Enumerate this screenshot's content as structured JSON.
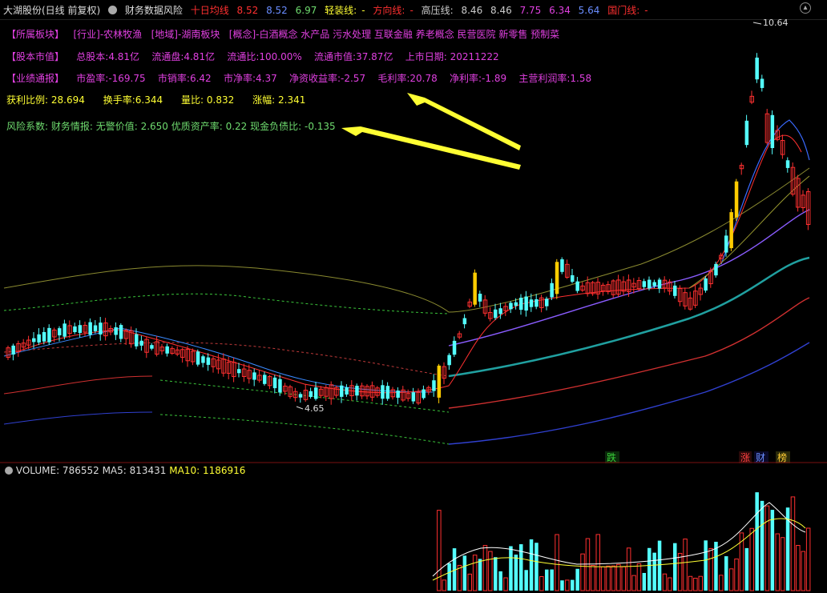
{
  "header": {
    "stock_title": "大湖股份(日线 前复权)",
    "indicator_name": "财务数据风险",
    "ma10_label": "十日均线",
    "ma10_v1": "8.52",
    "ma10_v2": "8.52",
    "ma10_v3": "6.97",
    "light_label": "轻装线:",
    "light_val": "-",
    "dir_label": "方向线:",
    "dir_val": "-",
    "press_label": "高压线:",
    "press_v1": "8.46",
    "press_v2": "8.46",
    "press_v3": "7.75",
    "press_v4": "6.34",
    "press_v5": "5.64",
    "guomen_label": "国门线:",
    "guomen_val": "-"
  },
  "info": {
    "sector_tag": "【所属板块】",
    "industry": "[行业]-农林牧渔",
    "region": "[地域]-湖南板块",
    "concept": "[概念]-白酒概念 水产品 污水处理 互联金融 养老概念 民营医院 新零售 预制菜",
    "capital_tag": "【股本市值】",
    "total_shares": "总股本:4.81亿",
    "float_shares": "流通盘:4.81亿",
    "float_ratio": "流通比:100.00%",
    "float_mv": "流通市值:37.87亿",
    "list_date": "上市日期: 20211222",
    "perf_tag": "【业绩通报】",
    "pe": "市盈率:-169.75",
    "ps": "市销率:6.42",
    "pb": "市净率:4.37",
    "roe": "净资收益率:-2.57",
    "gross_margin": "毛利率:20.78",
    "net_margin": "净利率:-1.89",
    "op_margin": "主营利润率:1.58",
    "profit_ratio": "获利比例: 28.694",
    "turnover": "换手率:6.344",
    "volume_ratio": "量比: 0.832",
    "amplitude": "涨幅: 2.341",
    "risk_line": "风险系数: 财务情报: 无警价值: 2.650 优质资产率: 0.22 现金负债比: -0.135"
  },
  "chart_labels": {
    "high_label": "10.64",
    "low_label": "4.65",
    "badge_die": "跌",
    "badge_zhang": "涨",
    "badge_cai": "财",
    "badge_bang": "榜"
  },
  "volume": {
    "label": "VOLUME: 786552",
    "ma5": "MA5: 813431",
    "ma10": "MA10: 1186916"
  },
  "colors": {
    "up": "#ff3030",
    "down": "#54ffff",
    "limit_up": "#ffcc00",
    "arrow": "#ffff33",
    "ma_short": "#ff3030",
    "ma_mid": "#8a5cff",
    "channel_top": "#9a9a3a",
    "channel_teal": "#20a0a0"
  },
  "chart_data": {
    "type": "candlestick",
    "price_high": 10.64,
    "price_low": 4.65,
    "volume_last": 786552,
    "volume_ma5": 813431,
    "volume_ma10": 1186916
  }
}
